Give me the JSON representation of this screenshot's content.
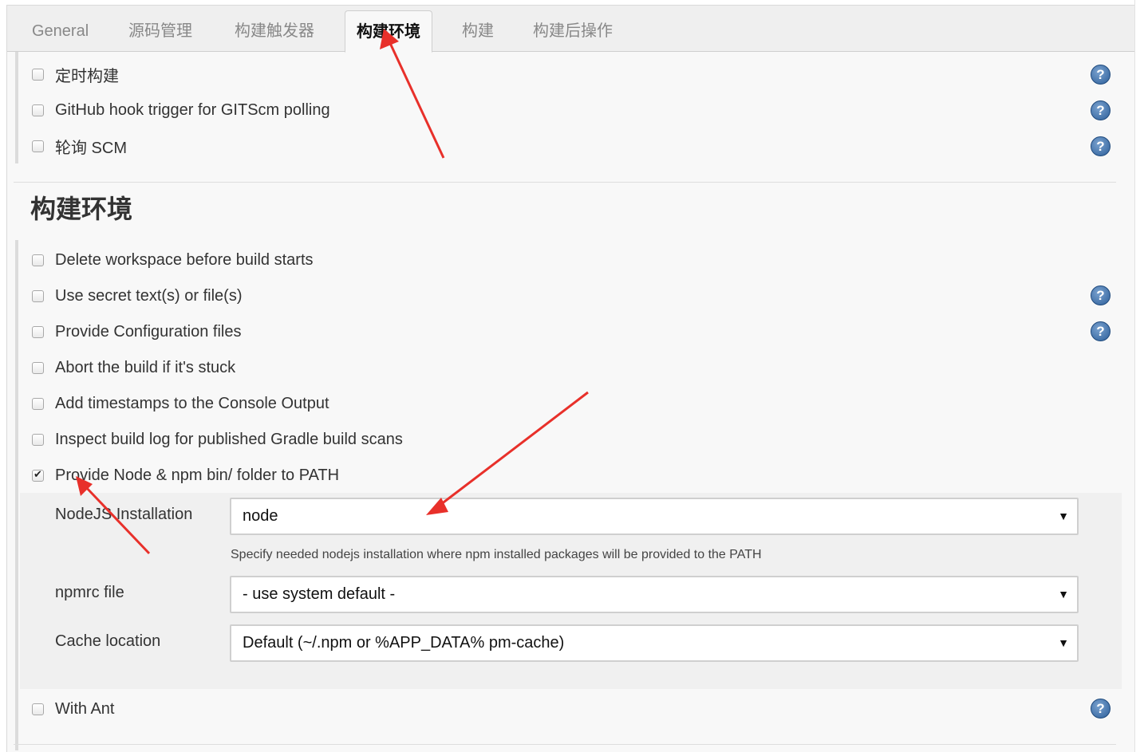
{
  "tabs": [
    {
      "label": "General",
      "active": false
    },
    {
      "label": "源码管理",
      "active": false
    },
    {
      "label": "构建触发器",
      "active": false
    },
    {
      "label": "构建环境",
      "active": true
    },
    {
      "label": "构建",
      "active": false
    },
    {
      "label": "构建后操作",
      "active": false
    }
  ],
  "triggers": {
    "items": [
      {
        "label": "定时构建",
        "checked": false,
        "help": true
      },
      {
        "label": "GitHub hook trigger for GITScm polling",
        "checked": false,
        "help": true
      },
      {
        "label": "轮询 SCM",
        "checked": false,
        "help": true
      }
    ]
  },
  "build_env": {
    "title": "构建环境",
    "items": [
      {
        "label": "Delete workspace before build starts",
        "checked": false,
        "help": false
      },
      {
        "label": "Use secret text(s) or file(s)",
        "checked": false,
        "help": true
      },
      {
        "label": "Provide Configuration files",
        "checked": false,
        "help": true
      },
      {
        "label": "Abort the build if it's stuck",
        "checked": false,
        "help": false
      },
      {
        "label": "Add timestamps to the Console Output",
        "checked": false,
        "help": false
      },
      {
        "label": "Inspect build log for published Gradle build scans",
        "checked": false,
        "help": false
      },
      {
        "label": "Provide Node & npm bin/ folder to PATH",
        "checked": true,
        "help": false
      }
    ],
    "node_settings": {
      "nodejs_label": "NodeJS Installation",
      "nodejs_value": "node",
      "nodejs_hint": "Specify needed nodejs installation where npm installed packages will be provided to the PATH",
      "npmrc_label": "npmrc file",
      "npmrc_value": "- use system default -",
      "cache_label": "Cache location",
      "cache_value": "Default (~/.npm or %APP_DATA% pm-cache)"
    },
    "with_ant": {
      "label": "With Ant",
      "checked": false,
      "help": true
    }
  },
  "icons": {
    "help": "help-icon",
    "dropdown": "chevron-down-icon",
    "check": "checkmark-icon"
  },
  "help_glyph": "?",
  "caret_glyph": "▼",
  "colors": {
    "annotation_arrow": "#e8302a",
    "help_icon": "#2d5f9a",
    "tab_active_text": "#111111"
  }
}
